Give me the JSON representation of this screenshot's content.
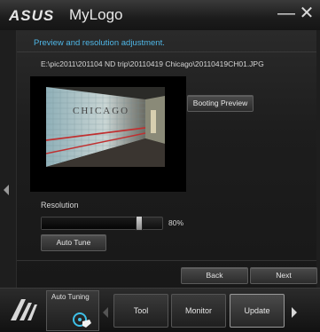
{
  "titlebar": {
    "app_title": "MyLogo",
    "brand": "ASUS",
    "minimize_glyph": "—",
    "close_glyph": "✕"
  },
  "section": {
    "title": "Preview and resolution adjustment."
  },
  "file_path": "E:\\pic2011\\201104 ND trip\\20110419 Chicago\\20110419CH01.JPG",
  "preview": {
    "booting_preview_label": "Booting Preview",
    "image_sign_text": "CHICAGO"
  },
  "resolution": {
    "label": "Resolution",
    "value": 80,
    "value_text": "80%",
    "auto_tune_label": "Auto Tune"
  },
  "wizard": {
    "back_label": "Back",
    "next_label": "Next"
  },
  "bottombar": {
    "auto_tuning_label": "Auto Tuning",
    "nav": [
      {
        "label": "Tool"
      },
      {
        "label": "Monitor"
      },
      {
        "label": "Update"
      }
    ]
  },
  "colors": {
    "accent": "#4fb6e6",
    "background": "#141414"
  }
}
